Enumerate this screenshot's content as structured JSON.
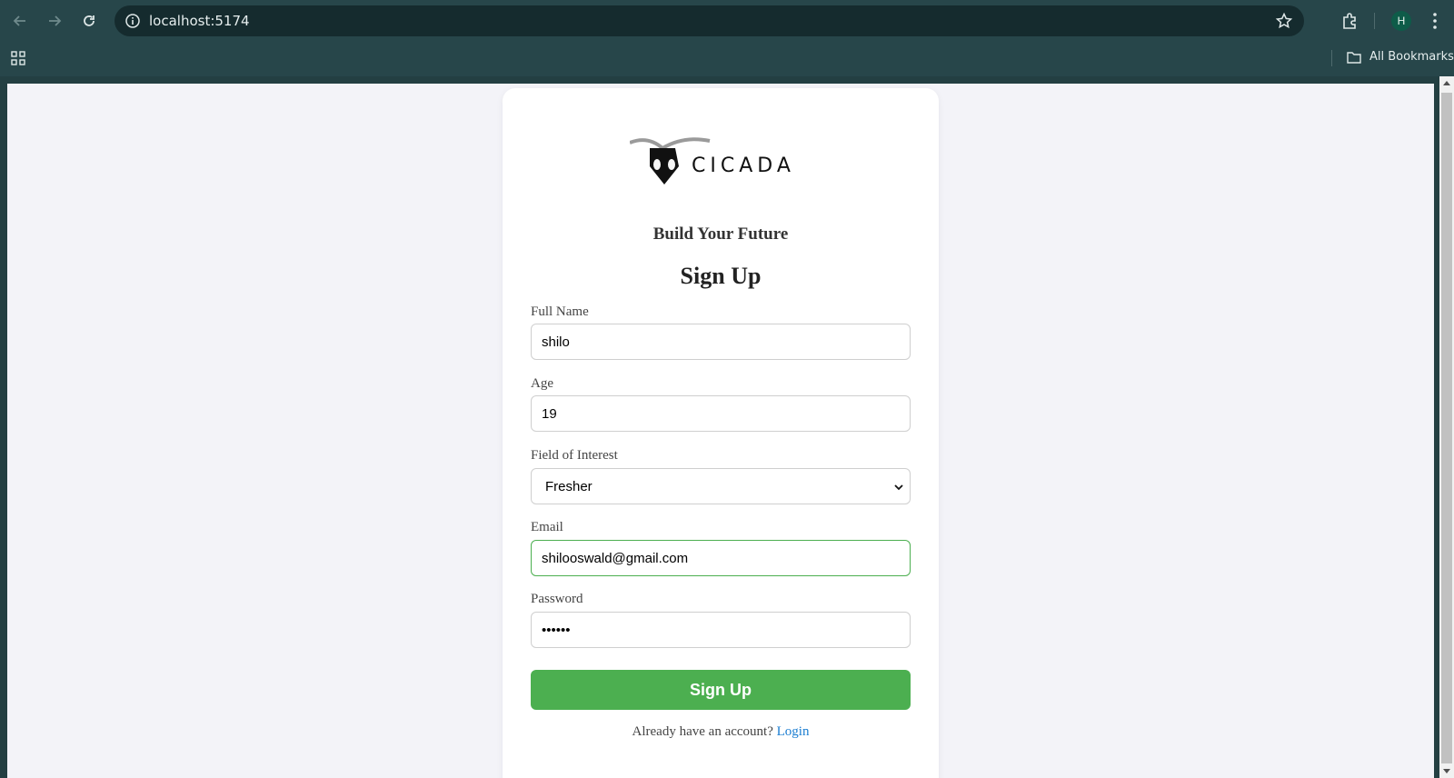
{
  "browser": {
    "url": "localhost:5174",
    "profile_initial": "H",
    "bookmarks_label": "All Bookmarks",
    "icons": [
      "back-icon",
      "forward-icon",
      "reload-icon",
      "info-icon",
      "star-icon",
      "extensions-icon",
      "kebab-menu-icon",
      "apps-grid-icon",
      "folder-icon"
    ]
  },
  "brand": {
    "logo_text": "CICADA",
    "tagline": "Build Your Future"
  },
  "form": {
    "title": "Sign Up",
    "full_name_label": "Full Name",
    "full_name_value": "shilo",
    "age_label": "Age",
    "age_value": "19",
    "field_label": "Field of Interest",
    "field_value": "Fresher",
    "email_label": "Email",
    "email_value": "shilooswald@gmail.com",
    "password_label": "Password",
    "password_value": "••••••",
    "submit_label": "Sign Up",
    "login_prompt": "Already have an account?",
    "login_link": "Login"
  },
  "colors": {
    "accent": "#4caf50",
    "link": "#1a7dd1",
    "chrome": "#27464a",
    "page_bg": "#f3f3f8"
  }
}
